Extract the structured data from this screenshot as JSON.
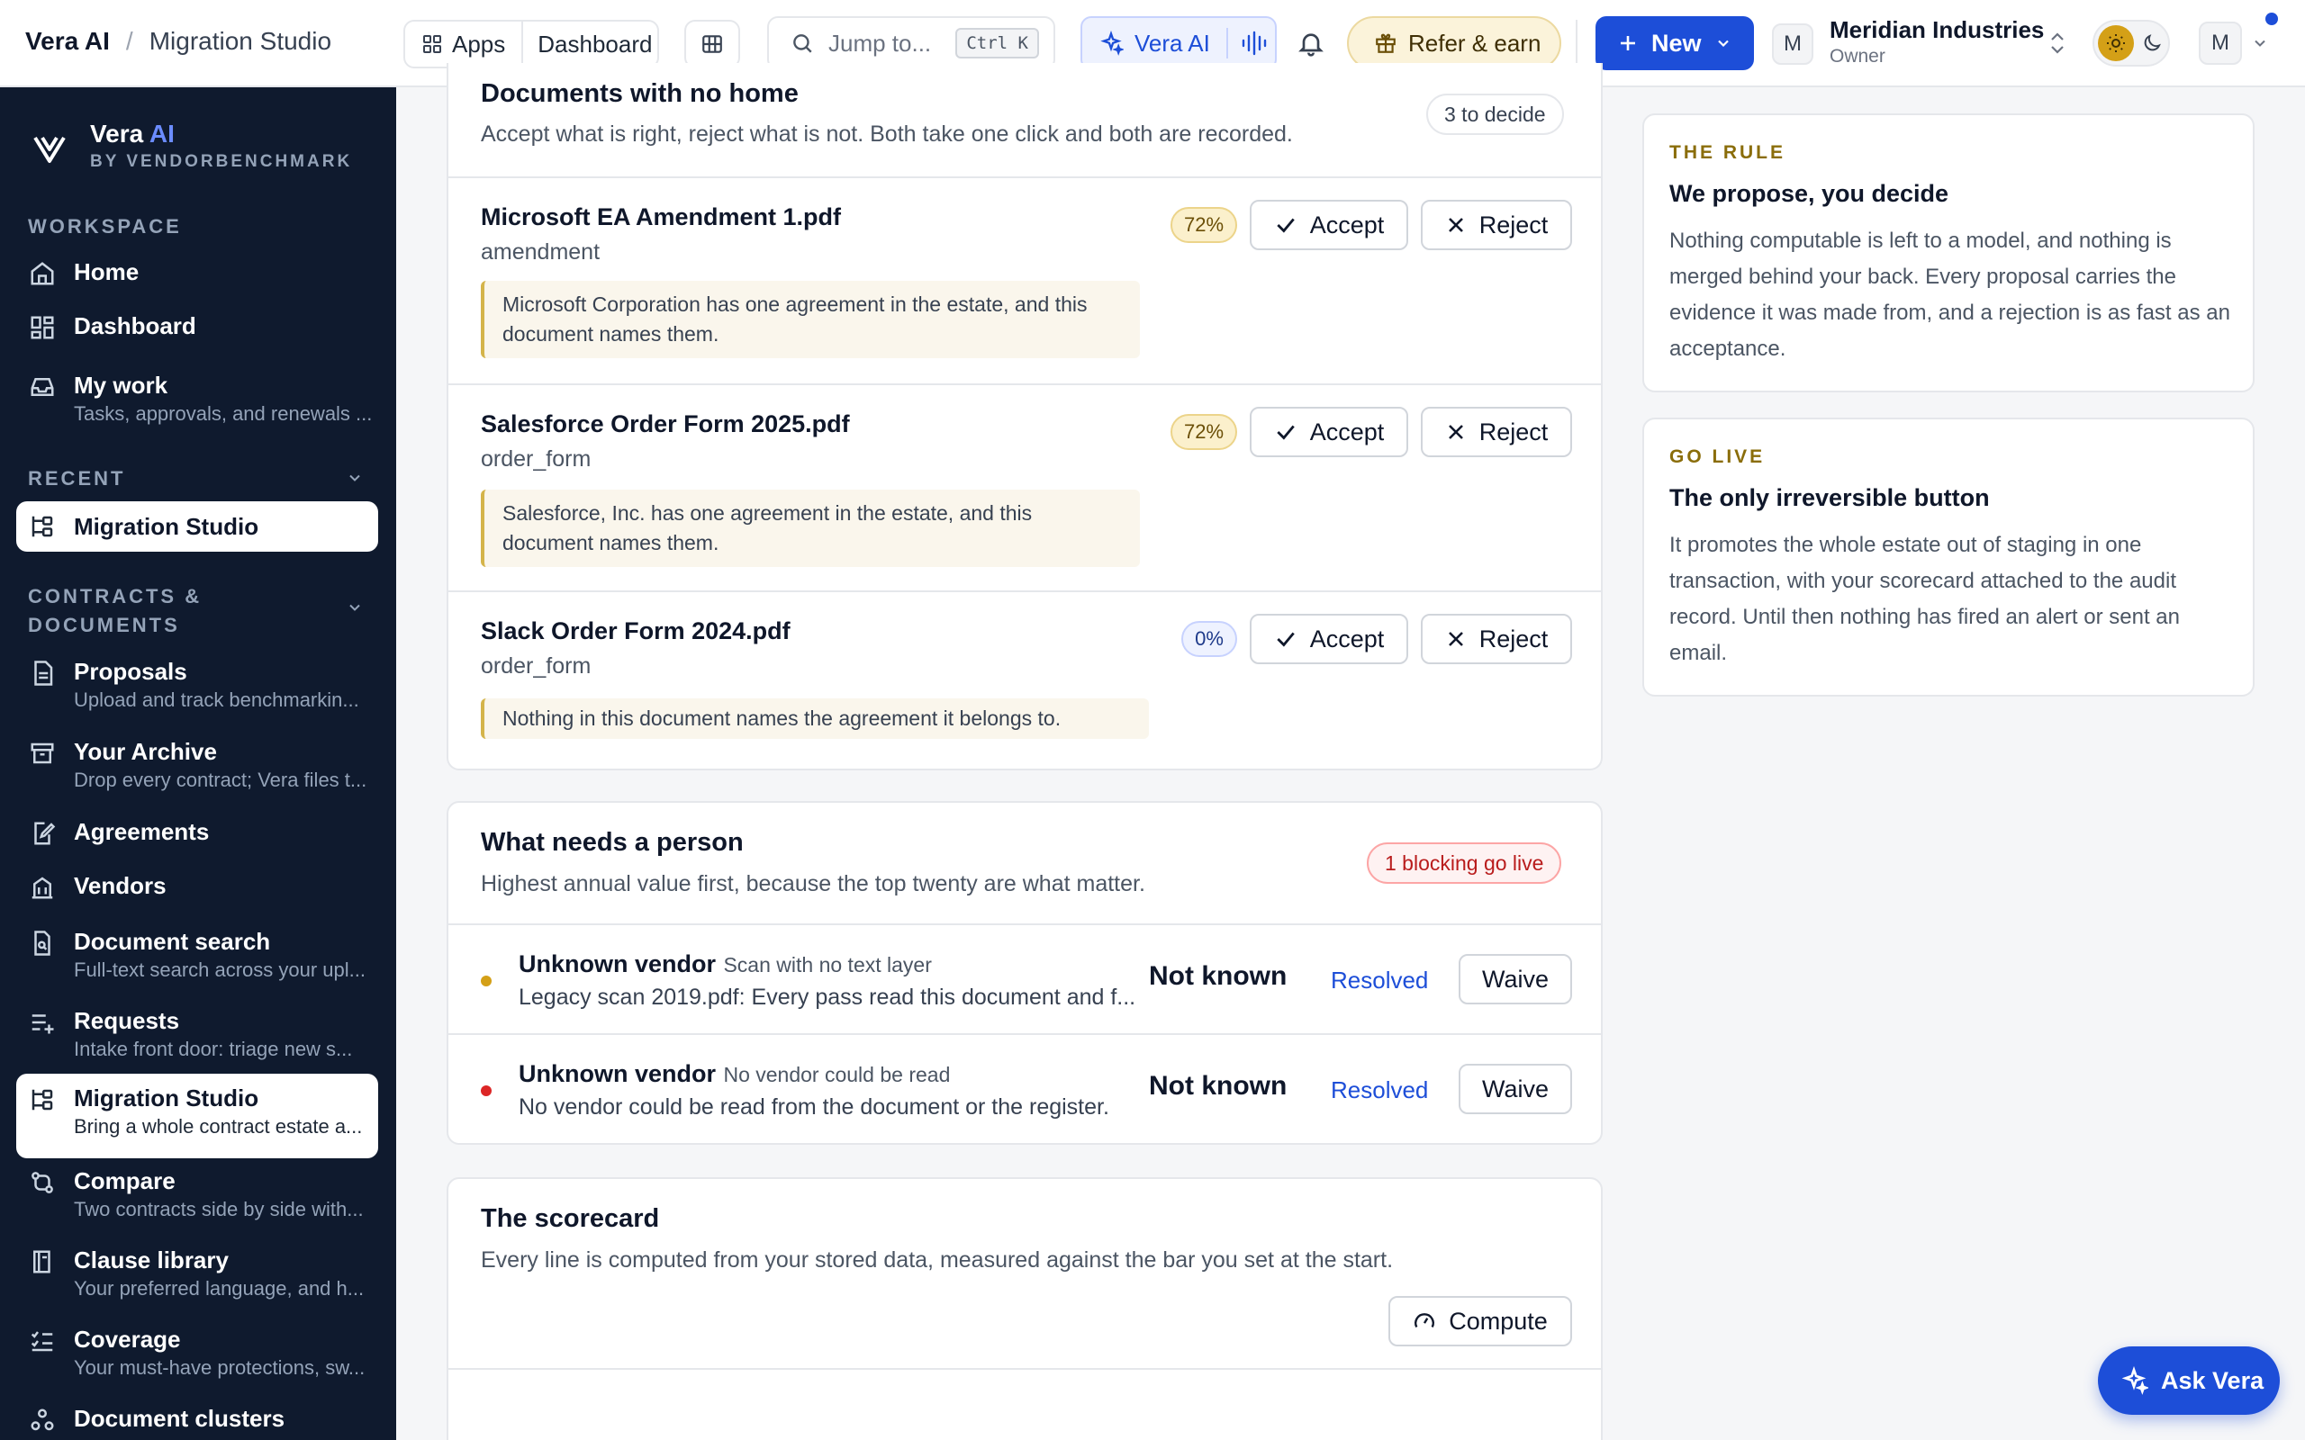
{
  "topbar": {
    "brand": "Vera AI",
    "sep": "/",
    "page": "Migration Studio",
    "apps": "Apps",
    "dashboard": "Dashboard",
    "jump": "Jump to...",
    "shortcut": "Ctrl K",
    "vera": "Vera AI",
    "refer": "Refer & earn",
    "new": "New",
    "org_initial": "M",
    "org_name": "Meridian Industries",
    "org_role": "Owner",
    "user_initial": "M"
  },
  "sidebar": {
    "brand_a": "Vera",
    "brand_b": "AI",
    "brand_by": "BY VENDORBENCHMARK",
    "workspace": "WORKSPACE",
    "recent": "RECENT",
    "contracts": "CONTRACTS &",
    "contracts2": "DOCUMENTS",
    "items": [
      {
        "label": "Home"
      },
      {
        "label": "Dashboard"
      },
      {
        "label": "My work",
        "desc": "Tasks, approvals, and renewals ..."
      },
      {
        "label": "Migration Studio"
      },
      {
        "label": "Proposals",
        "desc": "Upload and track benchmarkin..."
      },
      {
        "label": "Your Archive",
        "desc": "Drop every contract; Vera files t..."
      },
      {
        "label": "Agreements"
      },
      {
        "label": "Vendors"
      },
      {
        "label": "Document search",
        "desc": "Full-text search across your upl..."
      },
      {
        "label": "Requests",
        "desc": "Intake front door: triage new s..."
      },
      {
        "label": "Migration Studio",
        "desc": "Bring a whole contract estate a..."
      },
      {
        "label": "Compare",
        "desc": "Two contracts side by side with..."
      },
      {
        "label": "Clause library",
        "desc": "Your preferred language, and h..."
      },
      {
        "label": "Coverage",
        "desc": "Your must-have protections, sw..."
      },
      {
        "label": "Document clusters"
      }
    ]
  },
  "nohome": {
    "title": "Documents with no home",
    "subtitle": "Accept what is right, reject what is not. Both take one click and both are recorded.",
    "badge": "3 to decide",
    "accept": "Accept",
    "reject": "Reject",
    "docs": [
      {
        "name": "Microsoft EA Amendment 1.pdf",
        "type": "amendment",
        "conf": "72%",
        "note": "Microsoft Corporation has one agreement in the estate, and this document names them."
      },
      {
        "name": "Salesforce Order Form 2025.pdf",
        "type": "order_form",
        "conf": "72%",
        "note": "Salesforce, Inc. has one agreement in the estate, and this document names them."
      },
      {
        "name": "Slack Order Form 2024.pdf",
        "type": "order_form",
        "conf": "0%",
        "note": "Nothing in this document names the agreement it belongs to."
      }
    ]
  },
  "person": {
    "title": "What needs a person",
    "subtitle": "Highest annual value first, because the top twenty are what matter.",
    "badge": "1 blocking go live",
    "resolved": "Resolved",
    "waive": "Waive",
    "rows": [
      {
        "vendor": "Unknown vendor",
        "reason": "Scan with no text layer",
        "detail": "Legacy scan 2019.pdf: Every pass read this document and f...",
        "value": "Not known",
        "dot": "#d4a017"
      },
      {
        "vendor": "Unknown vendor",
        "reason": "No vendor could be read",
        "detail": "No vendor could be read from the document or the register.",
        "value": "Not known",
        "dot": "#dc2626"
      }
    ]
  },
  "scorecard": {
    "title": "The scorecard",
    "subtitle": "Every line is computed from your stored data, measured against the bar you set at the start.",
    "compute": "Compute"
  },
  "rule": {
    "label": "THE RULE",
    "title": "We propose, you decide",
    "body": "Nothing computable is left to a model, and nothing is merged behind your back. Every proposal carries the evidence it was made from, and a rejection is as fast as an acceptance."
  },
  "golive": {
    "label": "GO LIVE",
    "title": "The only irreversible button",
    "body": "It promotes the whole estate out of staging in one transaction, with your scorecard attached to the audit record. Until then nothing has fired an alert or sent an email."
  },
  "ask": "Ask Vera",
  "colors": {
    "accent": "#1d4ed8",
    "sidebar": "#0f1a2e",
    "warn": "#d4b44a"
  }
}
